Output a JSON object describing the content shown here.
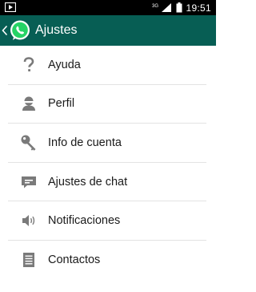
{
  "status_bar": {
    "time": "19:51",
    "network": "3G"
  },
  "action_bar": {
    "title": "Ajustes"
  },
  "settings": {
    "items": [
      {
        "label": "Ayuda",
        "icon": "help-icon"
      },
      {
        "label": "Perfil",
        "icon": "profile-icon"
      },
      {
        "label": "Info de cuenta",
        "icon": "key-icon"
      },
      {
        "label": "Ajustes de chat",
        "icon": "chat-icon"
      },
      {
        "label": "Notificaciones",
        "icon": "speaker-icon"
      },
      {
        "label": "Contactos",
        "icon": "contacts-icon"
      }
    ]
  },
  "colors": {
    "action_bar": "#075e54",
    "status_bar": "#000000",
    "icon_gray": "#7a7a7a"
  }
}
